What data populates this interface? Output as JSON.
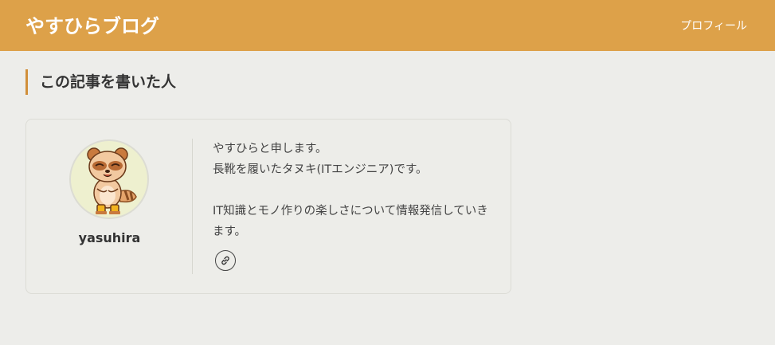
{
  "header": {
    "site_title": "やすひらブログ",
    "nav": {
      "profile_label": "プロフィール"
    },
    "background_color": "#dda149"
  },
  "section": {
    "heading": "この記事を書いた人",
    "accent_color": "#d18f3a"
  },
  "author": {
    "name": "yasuhira",
    "avatar_icon": "tanuki-icon",
    "bio_lines": [
      "やすひらと申します。",
      "長靴を履いたタヌキ(ITエンジニア)です。",
      "",
      "IT知識とモノ作りの楽しさについて情報発信していきます。"
    ],
    "link_icon": "link-icon"
  }
}
